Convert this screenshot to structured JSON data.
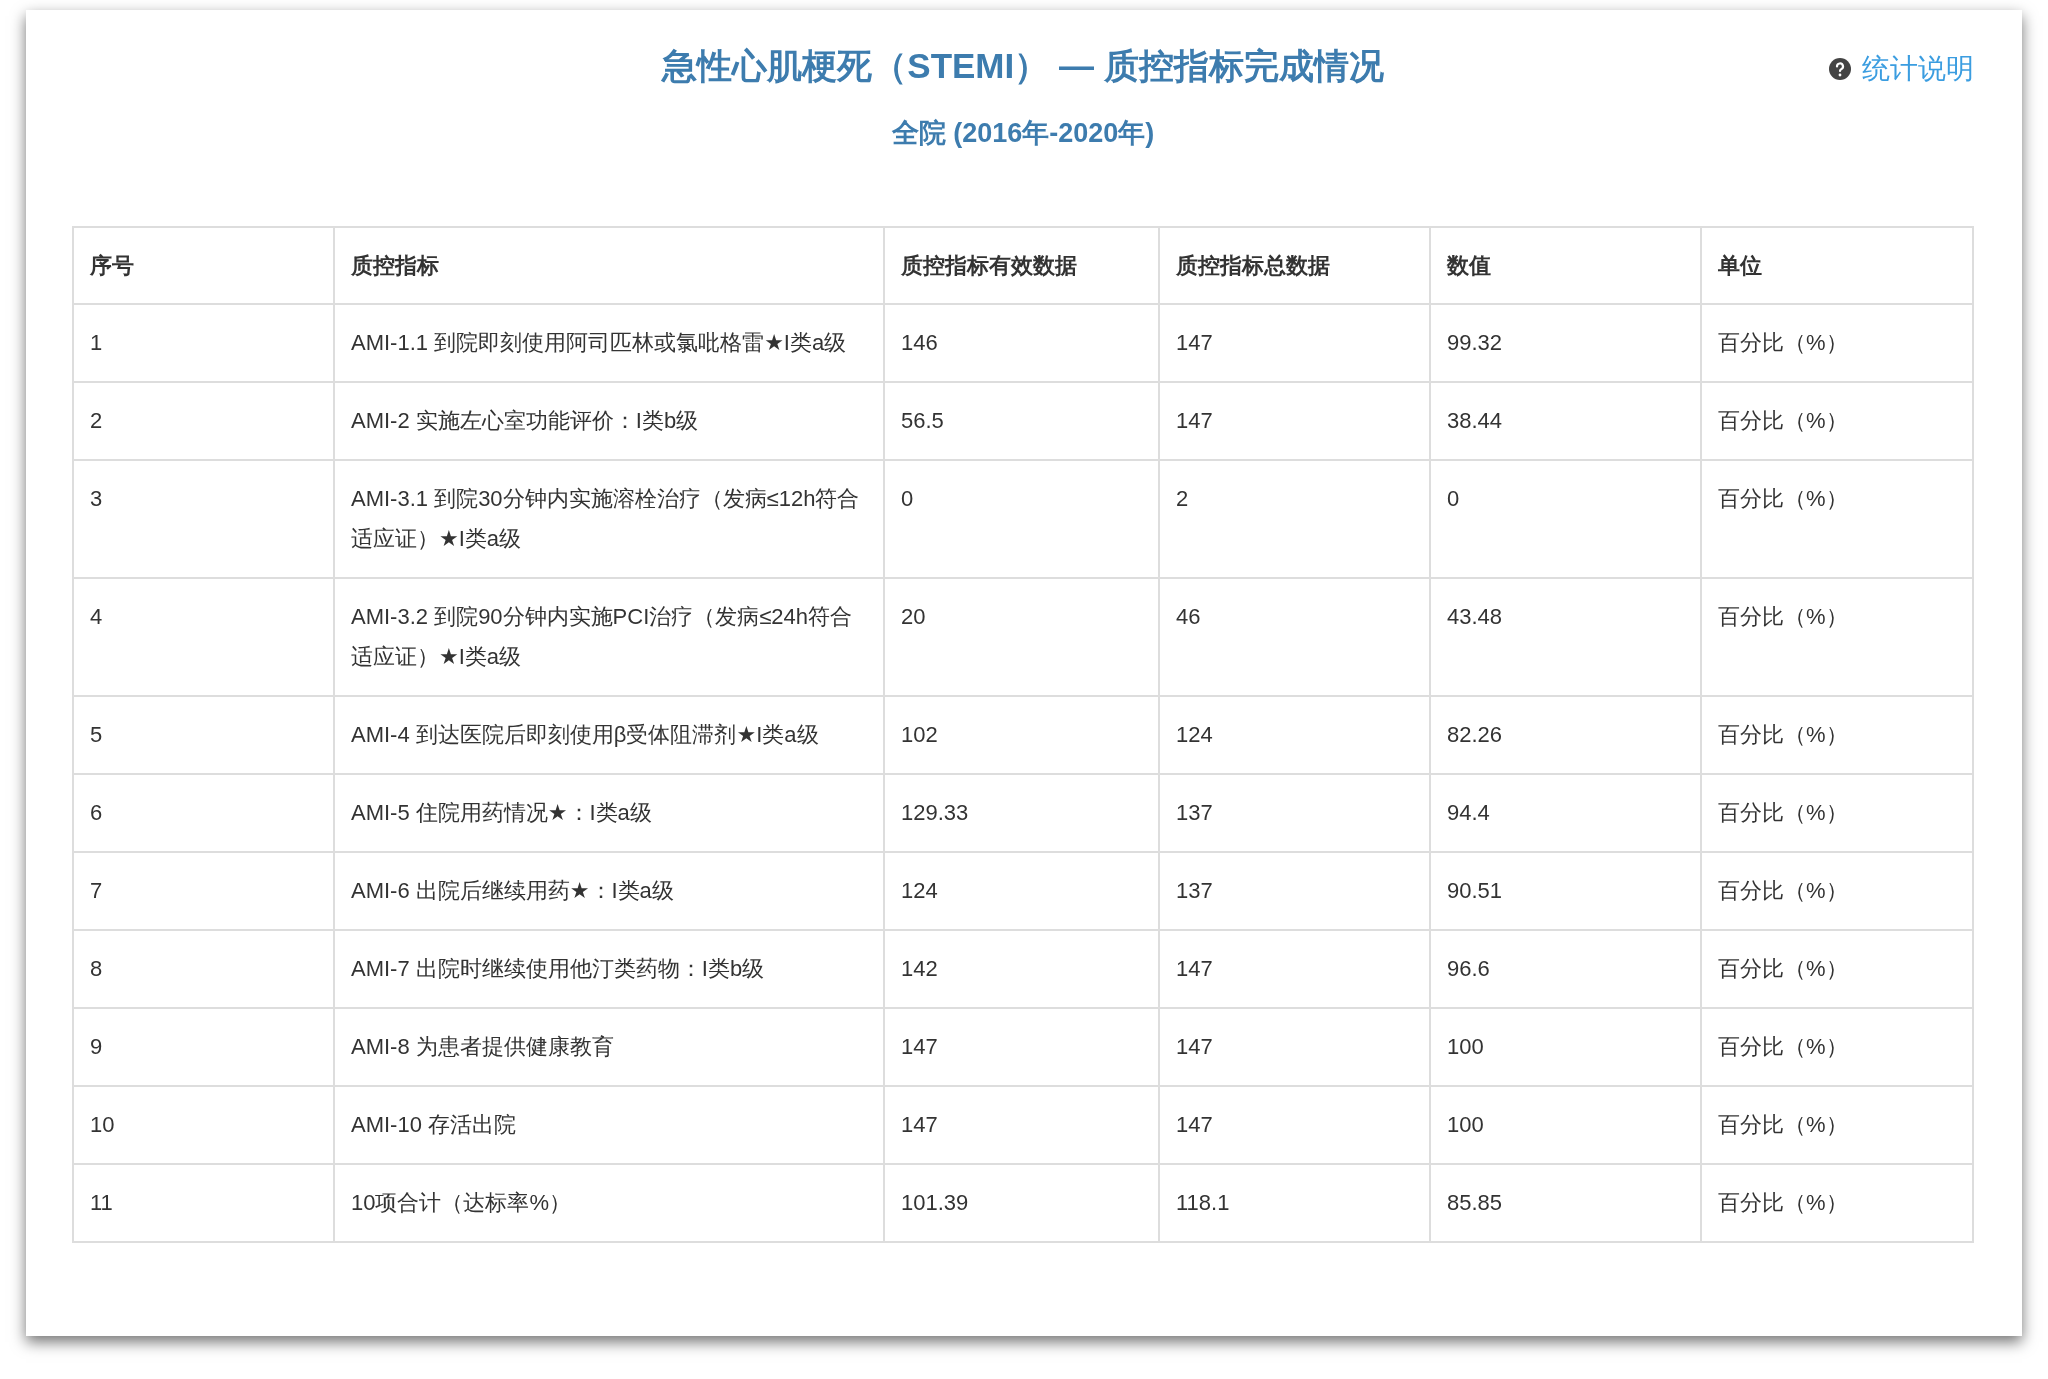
{
  "title": "急性心肌梗死（STEMI） — 质控指标完成情况",
  "subtitle": "全院 (2016年-2020年)",
  "help_link": "统计说明",
  "table": {
    "columns": [
      "序号",
      "质控指标",
      "质控指标有效数据",
      "质控指标总数据",
      "数值",
      "单位"
    ],
    "rows": [
      [
        "1",
        "AMI-1.1 到院即刻使用阿司匹林或氯吡格雷★I类a级",
        "146",
        "147",
        "99.32",
        "百分比（%）"
      ],
      [
        "2",
        "AMI-2 实施左心室功能评价：I类b级",
        "56.5",
        "147",
        "38.44",
        "百分比（%）"
      ],
      [
        "3",
        "AMI-3.1 到院30分钟内实施溶栓治疗（发病≤12h符合适应证）★I类a级",
        "0",
        "2",
        "0",
        "百分比（%）"
      ],
      [
        "4",
        "AMI-3.2 到院90分钟内实施PCI治疗（发病≤24h符合适应证）★I类a级",
        "20",
        "46",
        "43.48",
        "百分比（%）"
      ],
      [
        "5",
        "AMI-4 到达医院后即刻使用β受体阻滞剂★I类a级",
        "102",
        "124",
        "82.26",
        "百分比（%）"
      ],
      [
        "6",
        "AMI-5 住院用药情况★：I类a级",
        "129.33",
        "137",
        "94.4",
        "百分比（%）"
      ],
      [
        "7",
        "AMI-6 出院后继续用药★：I类a级",
        "124",
        "137",
        "90.51",
        "百分比（%）"
      ],
      [
        "8",
        "AMI-7 出院时继续使用他汀类药物：I类b级",
        "142",
        "147",
        "96.6",
        "百分比（%）"
      ],
      [
        "9",
        "AMI-8 为患者提供健康教育",
        "147",
        "147",
        "100",
        "百分比（%）"
      ],
      [
        "10",
        "AMI-10 存活出院",
        "147",
        "147",
        "100",
        "百分比（%）"
      ],
      [
        "11",
        "10项合计（达标率%）",
        "101.39",
        "118.1",
        "85.85",
        "百分比（%）"
      ]
    ]
  }
}
